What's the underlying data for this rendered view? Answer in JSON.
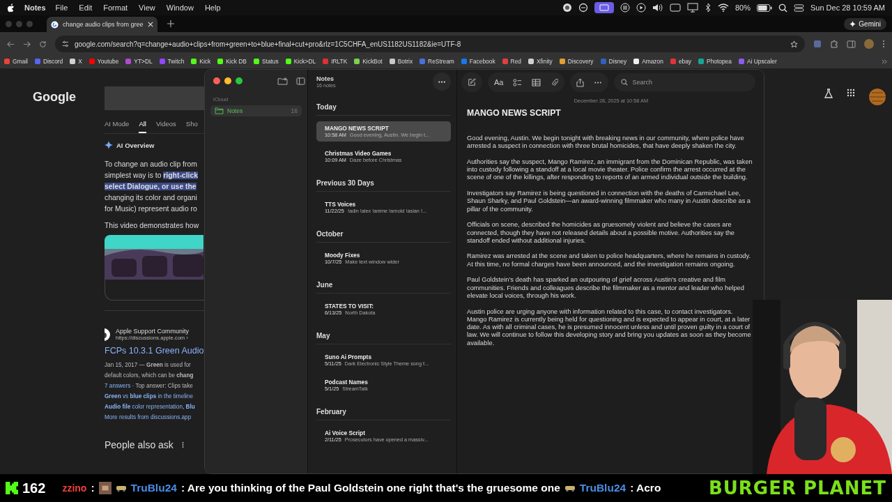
{
  "menu_bar": {
    "app": "Notes",
    "items": [
      "File",
      "Edit",
      "Format",
      "View",
      "Window",
      "Help"
    ],
    "battery": "80%",
    "clock": "Sun Dec 28  10:59 AM"
  },
  "browser": {
    "tab": {
      "title": "change audio clips from gree",
      "selected": true
    },
    "profile_button": "Gemini",
    "url": "google.com/search?q=change+audio+clips+from+green+to+blue+final+cut+pro&rlz=1C5CHFA_enUS1182US1182&ie=UTF-8",
    "bookmarks": [
      {
        "label": "Gmail",
        "color": "#ea4335"
      },
      {
        "label": "Discord",
        "color": "#5865f2"
      },
      {
        "label": "X",
        "color": "#d0d0d0"
      },
      {
        "label": "Youtube",
        "color": "#ff0000"
      },
      {
        "label": "YT>DL",
        "color": "#b04ad0"
      },
      {
        "label": "Twitch",
        "color": "#9146ff"
      },
      {
        "label": "Kick",
        "color": "#53fc18"
      },
      {
        "label": "Kick DB",
        "color": "#53fc18"
      },
      {
        "label": "Status",
        "color": "#53fc18"
      },
      {
        "label": "Kick>DL",
        "color": "#53fc18"
      },
      {
        "label": "IRLTK",
        "color": "#e03030"
      },
      {
        "label": "KickBot",
        "color": "#7bd44a"
      },
      {
        "label": "Botrix",
        "color": "#c8c8c8"
      },
      {
        "label": "ReStream",
        "color": "#4a6ee0"
      },
      {
        "label": "Facebook",
        "color": "#1877f2"
      },
      {
        "label": "Red",
        "color": "#e04040"
      },
      {
        "label": "Xfinity",
        "color": "#d0d0d0"
      },
      {
        "label": "Discovery",
        "color": "#e0a030"
      },
      {
        "label": "Disney",
        "color": "#3060c0"
      },
      {
        "label": "Amazon",
        "color": "#f0f0f0"
      },
      {
        "label": "ebay",
        "color": "#e53238"
      },
      {
        "label": "Photopea",
        "color": "#18a497"
      },
      {
        "label": "Ai Upscaler",
        "color": "#8a5cf0"
      }
    ]
  },
  "google": {
    "logo": "Google",
    "search_tabs": [
      {
        "label": "AI Mode",
        "selected": false
      },
      {
        "label": "All",
        "selected": true
      },
      {
        "label": "Videos",
        "selected": false
      },
      {
        "label": "Sho",
        "selected": false
      }
    ],
    "ai_overview": {
      "title": "AI Overview",
      "lines": [
        [
          {
            "text": "To change an audio clip from",
            "highlighted": false
          }
        ],
        [
          {
            "text": "simplest way is to ",
            "highlighted": false
          },
          {
            "text": "right-click",
            "highlighted": true
          }
        ],
        [
          {
            "text": "select Dialogue, or use the",
            "highlighted": true
          }
        ],
        [
          {
            "text": "changing its color and organi",
            "highlighted": false
          }
        ],
        [
          {
            "text": "for Music) represent audio ro",
            "highlighted": false
          }
        ]
      ],
      "video_caption": "This video demonstrates how"
    },
    "result": {
      "site": "Apple Support Community",
      "url": "https://discussions.apple.com ›",
      "title": "FCPs 10.3.1 Green Audio",
      "snippet": [
        "Jan 15, 2017 — **Green** is used for",
        "default colors, which can be **chang**"
      ],
      "answers": "7 answers",
      "answers_rest": " · Top answer: Clips take",
      "links": [
        "**Green** vs **blue clips** in the timeline",
        "**Audio file** color representation, **Blu**"
      ],
      "more": "More results from discussions.app"
    },
    "people_also_ask": "People also ask"
  },
  "notes": {
    "sidebar": {
      "account": "iCloud",
      "folders": [
        {
          "name": "Notes",
          "count": "16",
          "selected": true
        }
      ]
    },
    "list": {
      "title": "Notes",
      "count": "16 notes",
      "groups": [
        {
          "header": "Today",
          "notes": [
            {
              "title": "MANGO NEWS SCRIPT",
              "date": "10:58 AM",
              "preview": "Good evening, Austin. We begin t...",
              "selected": true
            },
            {
              "title": "Christmas Video Games",
              "date": "10:09 AM",
              "preview": "Daze before Christmas",
              "selected": false
            }
          ]
        },
        {
          "header": "Previous 30 Days",
          "notes": [
            {
              "title": "TTS Voices",
              "date": "11/22/25",
              "preview": "!adin !alex !anime !arnold !asian !...",
              "selected": false
            }
          ]
        },
        {
          "header": "October",
          "notes": [
            {
              "title": "Moody Fixes",
              "date": "10/7/25",
              "preview": "Make text window wider",
              "selected": false
            }
          ]
        },
        {
          "header": "June",
          "notes": [
            {
              "title": "STATES TO VISIT:",
              "date": "6/13/25",
              "preview": "North Dakota",
              "selected": false
            }
          ]
        },
        {
          "header": "May",
          "notes": [
            {
              "title": "Suno Ai Prompts",
              "date": "5/11/25",
              "preview": "Dark Electronic Style Theme song f...",
              "selected": false
            },
            {
              "title": "Podcast Names",
              "date": "5/1/25",
              "preview": "StreamTalk",
              "selected": false
            }
          ]
        },
        {
          "header": "February",
          "notes": [
            {
              "title": "Ai Voice Script",
              "date": "2/11/25",
              "preview": "Prosecutors have opened a massiv...",
              "selected": false
            }
          ]
        }
      ]
    },
    "editor": {
      "format_button": "Aa",
      "search_placeholder": "Search",
      "date": "December 28, 2025 at 10:58 AM",
      "title": "MANGO NEWS SCRIPT",
      "paragraphs": [
        "Good evening, Austin. We begin tonight with breaking news in our community, where police have arrested a suspect in connection with three brutal homicides, that have deeply shaken the city.",
        "Authorities say the suspect, Mango Ramirez, an immigrant from the Dominican Republic, was taken into custody following a standoff at a local movie theater. Police confirm the arrest occurred at the scene of one of the killings, after responding to reports of an armed individual outside the building.",
        "Investigators say Ramirez is being questioned in connection with the deaths of Carmichael Lee, Shaun Sharky, and Paul Goldstein—an award-winning filmmaker who many in Austin describe as a pillar of the community.",
        "Officials on scene, described the homicides as gruesomely violent and believe the cases are connected, though they have not released details about a possible motive. Authorities say the standoff ended without additional injuries.",
        "Ramirez was arrested at the scene and taken to police headquarters, where he remains in custody. At this time, no formal charges have been announced, and the investigation remains ongoing.",
        "Paul Goldstein's death has sparked an outpouring of grief across Austin's creative and film communities. Friends and colleagues describe the filmmaker as a mentor and leader who helped elevate local voices, through his work.",
        "Austin police are urging anyone with information related to this case, to contact investigators.\nMango Ramirez is currently being held for questioning and is expected to appear in court, at a later date. As with all criminal cases, he is presumed innocent unless and until proven guilty in a court of law. We will continue to follow this developing story and bring you updates as soon as they become available."
      ]
    }
  },
  "stream_overlay": {
    "viewer_count": "162",
    "chat": [
      {
        "user": "zzino",
        "message": ":"
      },
      {
        "user": "TruBlu24",
        "message": ": Are you thinking of the Paul Goldstein one right that's the gruesome one"
      },
      {
        "user": "TruBlu24",
        "message": ": Acro"
      }
    ],
    "banner": "BURGER PLANET"
  }
}
